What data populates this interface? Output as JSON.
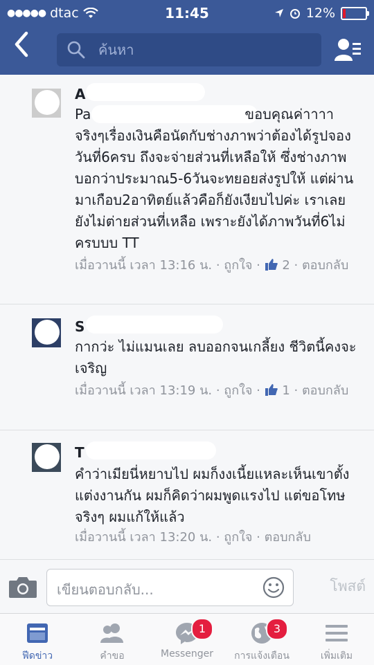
{
  "status": {
    "carrier": "dtac",
    "time": "11:45",
    "battery": "12%"
  },
  "search": {
    "placeholder": "ค้นหา"
  },
  "comments": [
    {
      "initial": "A",
      "line_start": "Pa",
      "text": "ขอบคุณค่าาาา จริงๆเรื่องเงินคือนัดกับช่างภาพว่าต้องได้รูปจองวันที่6ครบ ถึงจะจ่ายส่วนที่เหลือให้ ซึ่งช่างภาพบอกว่าประมาณ5-6วันจะทยอยส่งรูปให้ แต่ผ่านมาเกือบ2อาทิตย์แล้วคือก็ยังเงียบไปค่ะ เราเลยยังไม่ต่ายส่วนที่เหลือ เพราะยังได้ภาพวันที่6ไม่ครบบบ TT",
      "meta_time": "เมื่อวานนี้ เวลา 13:16 น.",
      "meta_like": "ถูกใจ",
      "like_count": "2",
      "meta_reply": "ตอบกลับ"
    },
    {
      "initial": "S",
      "text": "กากว่ะ ไม่แมนเลย ลบออกจนเกลี้ยง ชีวิตนี้คงจะเจริญ",
      "meta_time": "เมื่อวานนี้ เวลา 13:19 น.",
      "meta_like": "ถูกใจ",
      "like_count": "1",
      "meta_reply": "ตอบกลับ"
    },
    {
      "initial": "T",
      "text": "คำว่าเมียนี่หยาบไป ผมก็งงเนี้ยแหละเห็นเขาตั้งแต่งงานกัน ผมก็คิดว่าผมพูดแรงไป แต่ขอโทษจริงๆ ผมแก้ให้แล้ว",
      "meta_time": "เมื่อวานนี้ เวลา 13:20 น.",
      "meta_like": "ถูกใจ",
      "meta_reply": "ตอบกลับ"
    }
  ],
  "reply": {
    "placeholder": "เขียนตอบกลับ...",
    "post_label": "โพสต์"
  },
  "tabs": [
    {
      "label": "ฟีดข่าว"
    },
    {
      "label": "คำขอ"
    },
    {
      "label": "Messenger",
      "badge": "1"
    },
    {
      "label": "การแจ้งเตือน",
      "badge": "3"
    },
    {
      "label": "เพิ่มเติม"
    }
  ],
  "colors": {
    "header": "#3b5998",
    "accent": "#4267b2",
    "badge": "#e41e3f"
  }
}
